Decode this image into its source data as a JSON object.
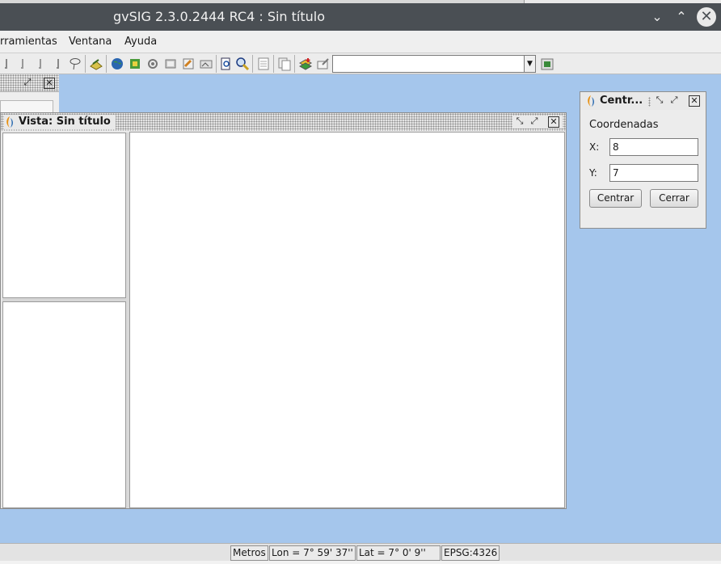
{
  "window": {
    "title": "gvSIG 2.3.0.2444 RC4 : Sin título",
    "minimize_glyph": "⌄",
    "maximize_glyph": "⌃",
    "close_glyph": "✕"
  },
  "menu": {
    "items": [
      {
        "label": "rramientas"
      },
      {
        "label": "Ventana"
      },
      {
        "label": "Ayuda"
      }
    ]
  },
  "toolbar": {
    "icons": [
      "pointer-icon",
      "pointer-icon",
      "pointer-icon",
      "pointer-icon",
      "lasso-select-icon",
      "layer-edit-icon",
      "globe-icon",
      "raster-icon",
      "gear-icon",
      "layer-props-icon",
      "print-icon",
      "picture-icon",
      "zoom-page-icon",
      "zoom-search-icon",
      "table-icon",
      "copy-icon",
      "add-layer-icon",
      "edit-layer-icon",
      "export-icon"
    ],
    "scale_combo_value": ""
  },
  "vista": {
    "title": "Vista: Sin título"
  },
  "centrar": {
    "title": "Centr...",
    "section": "Coordenadas",
    "x_label": "X:",
    "x_value": "8",
    "y_label": "Y:",
    "y_value": "7",
    "centrar_button": "Centrar",
    "cerrar_button": "Cerrar"
  },
  "status": {
    "units": "Metros",
    "lon": "Lon = 7° 59' 37''",
    "lat": "Lat = 7° 0' 9''",
    "crs": "EPSG:4326"
  },
  "colors": {
    "desktop_bg": "#a5c6ec",
    "titlebar_bg": "#4a4f54"
  }
}
